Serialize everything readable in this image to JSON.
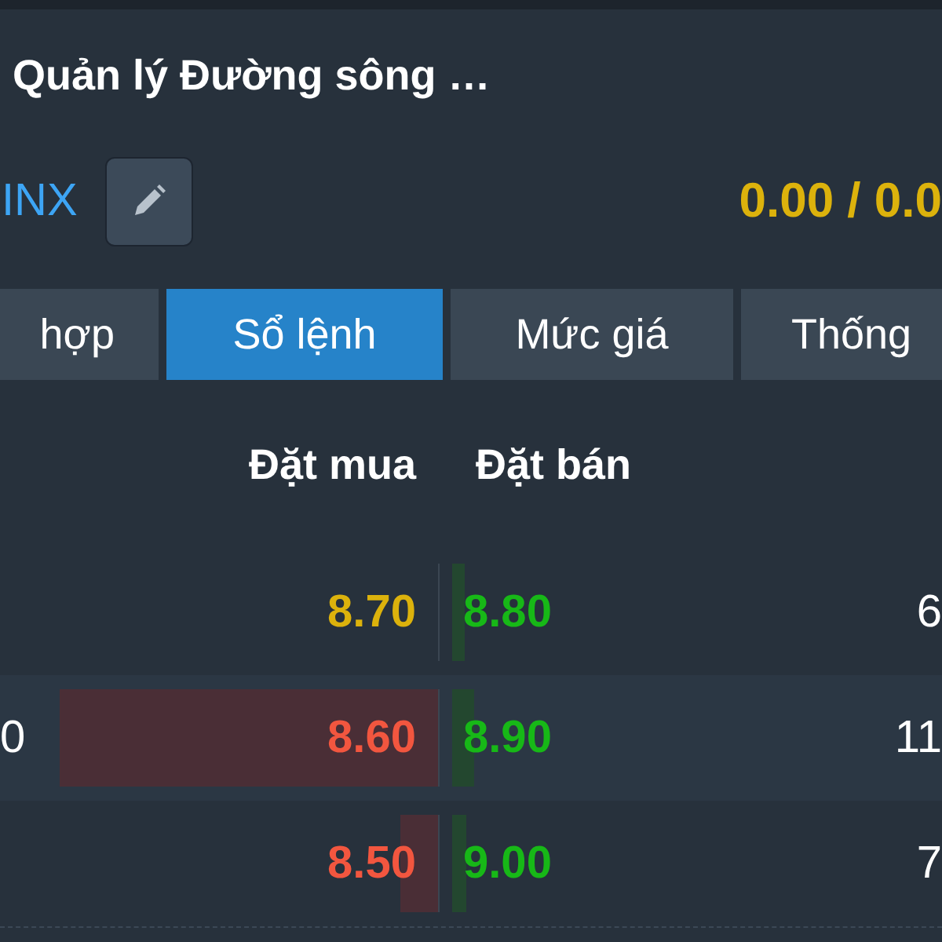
{
  "header": {
    "title": "Quản lý Đường sông …",
    "symbol": "INX",
    "price_ratio": "0.00 / 0.0"
  },
  "tabs": [
    {
      "label": "hợp",
      "selected": false
    },
    {
      "label": "Sổ lệnh",
      "selected": true
    },
    {
      "label": "Mức giá",
      "selected": false
    },
    {
      "label": "Thống",
      "selected": false
    }
  ],
  "order_book": {
    "columns": [
      "Đặt mua",
      "Đặt bán"
    ],
    "rows": [
      {
        "bid": {
          "price": "8.70",
          "color": "#dcb20c"
        },
        "ask": {
          "price": "8.80",
          "color": "#17b817",
          "volume": "6"
        }
      },
      {
        "bid": {
          "volume": "0",
          "price": "8.60",
          "color": "#f2563f",
          "level": 1
        },
        "ask": {
          "price": "8.90",
          "color": "#17b817",
          "volume": "11"
        }
      },
      {
        "bid": {
          "price": "8.50",
          "color": "#f2563f",
          "level": 0.1
        },
        "ask": {
          "price": "9.00",
          "color": "#17b817",
          "volume": "7"
        }
      }
    ]
  }
}
